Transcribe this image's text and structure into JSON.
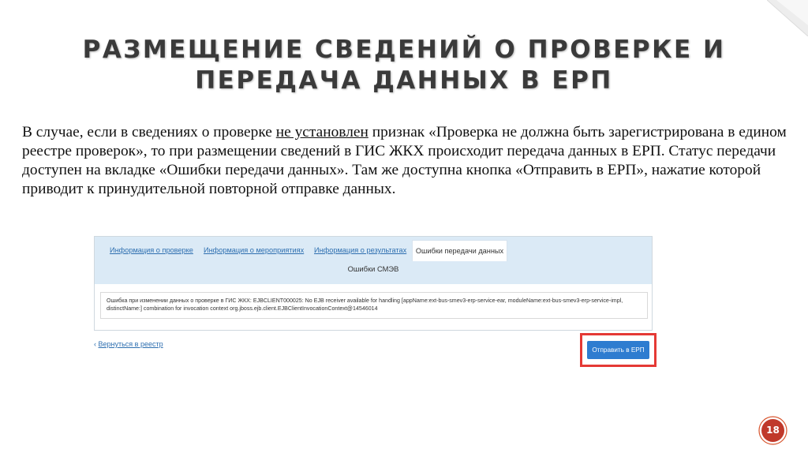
{
  "slide": {
    "title_line1": "РАЗМЕЩЕНИЕ СВЕДЕНИЙ О ПРОВЕРКЕ И",
    "title_line2": "ПЕРЕДАЧА ДАННЫХ В ЕРП",
    "para_before": "В случае, если в сведениях о проверке ",
    "para_underlined": "не установлен",
    "para_after": " признак «Проверка не должна быть зарегистрирована в едином реестре проверок», то при размещении сведений в ГИС ЖКХ происходит передача данных в ЕРП. Статус передачи доступен на вкладке «Ошибки передачи данных». Там же доступна кнопка «Отправить в ЕРП», нажатие которой приводит к принудительной повторной отправке данных.",
    "page_number": "18"
  },
  "screenshot": {
    "tabs": [
      {
        "label": "Информация о проверке"
      },
      {
        "label": "Информация о мероприятиях"
      },
      {
        "label": "Информация о результатах"
      }
    ],
    "active_tab": "Ошибки передачи данных",
    "section_title": "Ошибки СМЭВ",
    "error_message": "Ошибка при изменении данных о проверке в ГИС ЖКХ: EJBCLIENT000025: No EJB receiver available for handling [appName:ext-bus-smev3-erp-service-ear, moduleName:ext-bus-smev3-erp-service-impl, distinctName:] combination for invocation context org.jboss.ejb.client.EJBClientInvocationContext@14546014",
    "back_arrow": "‹",
    "back_link": "Вернуться в реестр",
    "send_button": "Отправить в ЕРП"
  },
  "colors": {
    "title": "#3a3a3a",
    "tab_bar": "#dbeaf6",
    "link": "#2e6fb0",
    "button": "#2e7cd0",
    "highlight": "#e53935",
    "badge": "#c0392b"
  },
  "icons": {
    "corner": "corner-decoration-icon",
    "badge": "page-number-badge"
  }
}
